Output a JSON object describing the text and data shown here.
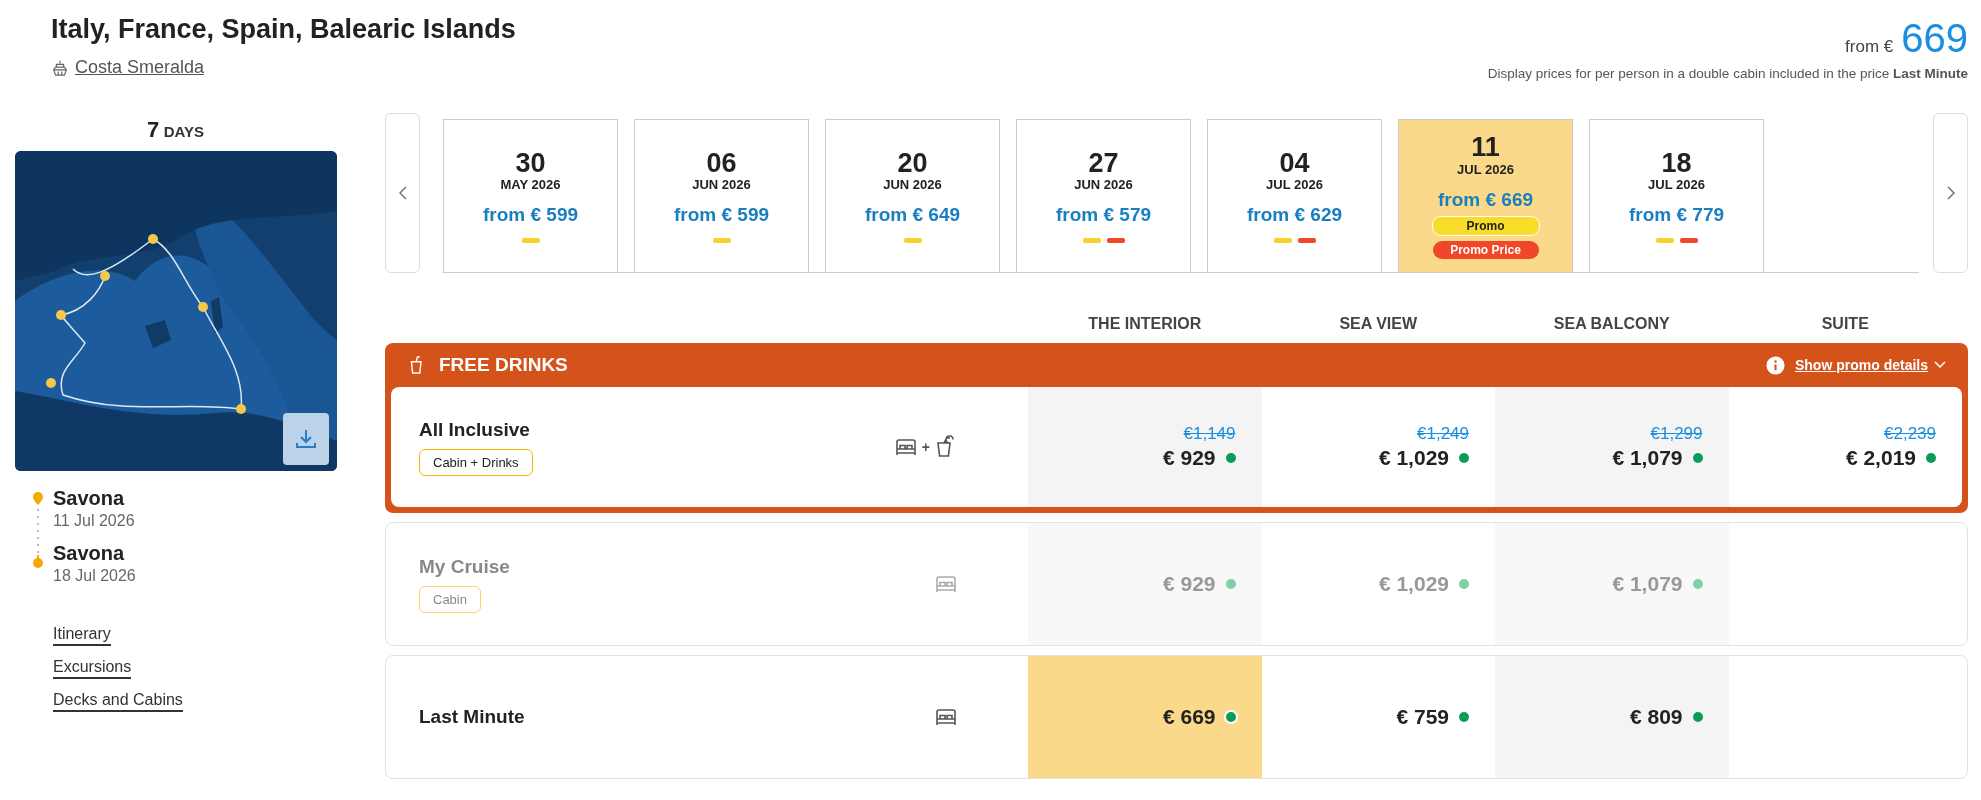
{
  "header": {
    "title": "Italy, France, Spain, Balearic Islands",
    "ship": "Costa Smeralda"
  },
  "price_summary": {
    "prefix": "from €",
    "amount": "669",
    "note": "Display prices for per person in a double cabin included in the price **Last Minute**"
  },
  "duration": {
    "number": "7",
    "unit": "DAYS"
  },
  "itinerary": [
    {
      "port": "Savona",
      "date": "11 Jul 2026"
    },
    {
      "port": "Savona",
      "date": "18 Jul 2026"
    }
  ],
  "links": [
    "Itinerary",
    "Excursions",
    "Decks and Cabins"
  ],
  "dates": [
    {
      "day": "30",
      "month": "MAY 2026",
      "price": "from € 599",
      "selected": false,
      "markers": [
        {
          "color": "#f7d22c"
        }
      ]
    },
    {
      "day": "06",
      "month": "JUN 2026",
      "price": "from € 599",
      "selected": false,
      "markers": [
        {
          "color": "#f7d22c"
        }
      ]
    },
    {
      "day": "20",
      "month": "JUN 2026",
      "price": "from € 649",
      "selected": false,
      "markers": [
        {
          "color": "#f7d22c"
        }
      ]
    },
    {
      "day": "27",
      "month": "JUN 2026",
      "price": "from € 579",
      "selected": false,
      "markers": [
        {
          "color": "#f7d22c"
        },
        {
          "color": "#f0462a"
        }
      ]
    },
    {
      "day": "04",
      "month": "JUL 2026",
      "price": "from € 629",
      "selected": false,
      "markers": [
        {
          "color": "#f7d22c"
        },
        {
          "color": "#f0462a"
        }
      ]
    },
    {
      "day": "11",
      "month": "JUL 2026",
      "price": "from € 669",
      "selected": true,
      "badges": [
        {
          "kind": "promo",
          "label": "Promo"
        },
        {
          "kind": "promo-price",
          "label": "Promo Price"
        }
      ]
    },
    {
      "day": "18",
      "month": "JUL 2026",
      "price": "from € 779",
      "selected": false,
      "markers": [
        {
          "color": "#f7d22c"
        },
        {
          "color": "#f0462a"
        }
      ]
    }
  ],
  "cabin_columns": [
    "THE INTERIOR",
    "SEA VIEW",
    "SEA BALCONY",
    "SUITE"
  ],
  "promo": {
    "title": "FREE DRINKS",
    "link": "Show promo details"
  },
  "rates": [
    {
      "name": "All Inclusive",
      "tag": "Cabin + Drinks",
      "kind": "cabin-drinks",
      "icon_separator": "+",
      "promoted": true,
      "disabled": false,
      "prices": [
        {
          "old": "€1,149",
          "price": "€ 929",
          "selected": false
        },
        {
          "old": "€1,249",
          "price": "€ 1,029",
          "selected": false
        },
        {
          "old": "€1,299",
          "price": "€ 1,079",
          "selected": false
        },
        {
          "old": "€2,239",
          "price": "€ 2,019",
          "selected": false
        }
      ]
    },
    {
      "name": "My Cruise",
      "tag": "Cabin",
      "kind": "cabin",
      "promoted": false,
      "disabled": true,
      "prices": [
        {
          "price": "€ 929",
          "selected": false
        },
        {
          "price": "€ 1,029",
          "selected": false
        },
        {
          "price": "€ 1,079",
          "selected": false
        }
      ]
    },
    {
      "name": "Last Minute",
      "kind": "cabin",
      "promoted": false,
      "disabled": false,
      "prices": [
        {
          "price": "€ 669",
          "selected": true
        },
        {
          "price": "€ 759",
          "selected": false
        },
        {
          "price": "€ 809",
          "selected": false
        }
      ]
    }
  ]
}
